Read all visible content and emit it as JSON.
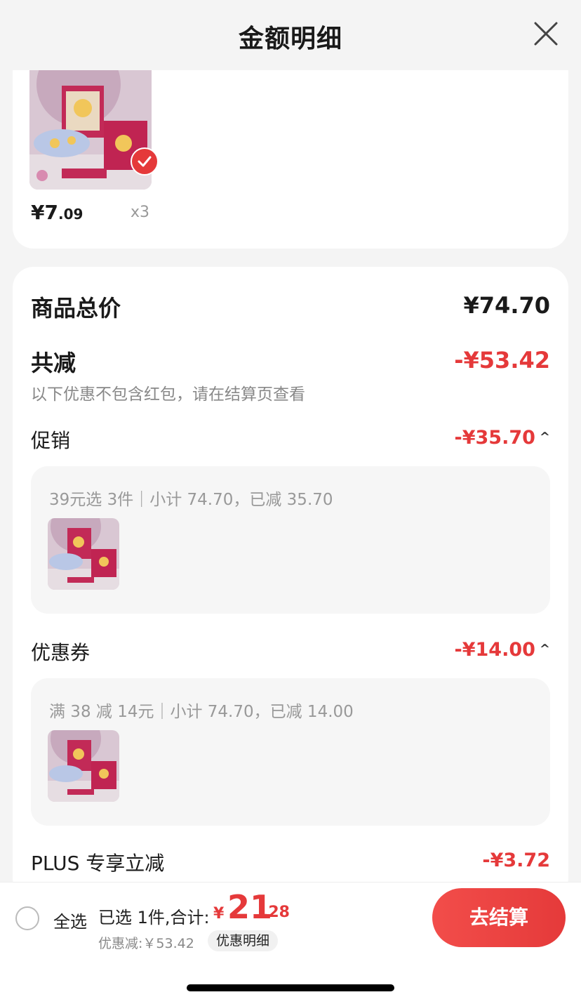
{
  "header": {
    "title": "金额明细",
    "close_icon": "close-icon"
  },
  "product": {
    "price_int": "¥7",
    "price_dec": ".09",
    "quantity": "x3",
    "selected": true
  },
  "summary": {
    "total_label": "商品总价",
    "total_value": "¥74.70",
    "reduce_label": "共减",
    "reduce_value": "-¥53.42",
    "note": "以下优惠不包含红包，请在结算页查看"
  },
  "promotion": {
    "label": "促销",
    "value": "-¥35.70",
    "detail": "39元选 3件｜小计 74.70，已减 35.70"
  },
  "coupon": {
    "label": "优惠券",
    "value": "-¥14.00",
    "detail": "满 38 减 14元｜小计 74.70，已减 14.00"
  },
  "plus": {
    "label": "PLUS 专享立减",
    "value": "-¥3.72"
  },
  "bottom": {
    "select_all": "全选",
    "selected_text": "已选 1件,合计:",
    "currency": "¥",
    "total_int": "21",
    "total_dec": ".28",
    "discount_text": "优惠减:￥53.42",
    "detail_button": "优惠明细",
    "checkout_button": "去结算"
  },
  "colors": {
    "accent": "#e5393a",
    "background": "#f4f4f4"
  }
}
